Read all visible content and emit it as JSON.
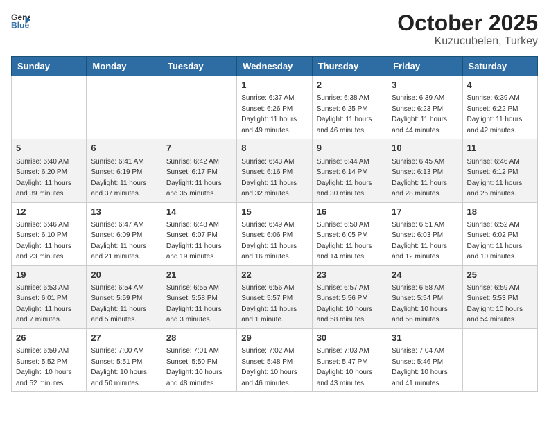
{
  "header": {
    "logo_general": "General",
    "logo_blue": "Blue",
    "title": "October 2025",
    "subtitle": "Kuzucubelen, Turkey"
  },
  "weekdays": [
    "Sunday",
    "Monday",
    "Tuesday",
    "Wednesday",
    "Thursday",
    "Friday",
    "Saturday"
  ],
  "weeks": [
    [
      {
        "day": "",
        "info": ""
      },
      {
        "day": "",
        "info": ""
      },
      {
        "day": "",
        "info": ""
      },
      {
        "day": "1",
        "info": "Sunrise: 6:37 AM\nSunset: 6:26 PM\nDaylight: 11 hours\nand 49 minutes."
      },
      {
        "day": "2",
        "info": "Sunrise: 6:38 AM\nSunset: 6:25 PM\nDaylight: 11 hours\nand 46 minutes."
      },
      {
        "day": "3",
        "info": "Sunrise: 6:39 AM\nSunset: 6:23 PM\nDaylight: 11 hours\nand 44 minutes."
      },
      {
        "day": "4",
        "info": "Sunrise: 6:39 AM\nSunset: 6:22 PM\nDaylight: 11 hours\nand 42 minutes."
      }
    ],
    [
      {
        "day": "5",
        "info": "Sunrise: 6:40 AM\nSunset: 6:20 PM\nDaylight: 11 hours\nand 39 minutes."
      },
      {
        "day": "6",
        "info": "Sunrise: 6:41 AM\nSunset: 6:19 PM\nDaylight: 11 hours\nand 37 minutes."
      },
      {
        "day": "7",
        "info": "Sunrise: 6:42 AM\nSunset: 6:17 PM\nDaylight: 11 hours\nand 35 minutes."
      },
      {
        "day": "8",
        "info": "Sunrise: 6:43 AM\nSunset: 6:16 PM\nDaylight: 11 hours\nand 32 minutes."
      },
      {
        "day": "9",
        "info": "Sunrise: 6:44 AM\nSunset: 6:14 PM\nDaylight: 11 hours\nand 30 minutes."
      },
      {
        "day": "10",
        "info": "Sunrise: 6:45 AM\nSunset: 6:13 PM\nDaylight: 11 hours\nand 28 minutes."
      },
      {
        "day": "11",
        "info": "Sunrise: 6:46 AM\nSunset: 6:12 PM\nDaylight: 11 hours\nand 25 minutes."
      }
    ],
    [
      {
        "day": "12",
        "info": "Sunrise: 6:46 AM\nSunset: 6:10 PM\nDaylight: 11 hours\nand 23 minutes."
      },
      {
        "day": "13",
        "info": "Sunrise: 6:47 AM\nSunset: 6:09 PM\nDaylight: 11 hours\nand 21 minutes."
      },
      {
        "day": "14",
        "info": "Sunrise: 6:48 AM\nSunset: 6:07 PM\nDaylight: 11 hours\nand 19 minutes."
      },
      {
        "day": "15",
        "info": "Sunrise: 6:49 AM\nSunset: 6:06 PM\nDaylight: 11 hours\nand 16 minutes."
      },
      {
        "day": "16",
        "info": "Sunrise: 6:50 AM\nSunset: 6:05 PM\nDaylight: 11 hours\nand 14 minutes."
      },
      {
        "day": "17",
        "info": "Sunrise: 6:51 AM\nSunset: 6:03 PM\nDaylight: 11 hours\nand 12 minutes."
      },
      {
        "day": "18",
        "info": "Sunrise: 6:52 AM\nSunset: 6:02 PM\nDaylight: 11 hours\nand 10 minutes."
      }
    ],
    [
      {
        "day": "19",
        "info": "Sunrise: 6:53 AM\nSunset: 6:01 PM\nDaylight: 11 hours\nand 7 minutes."
      },
      {
        "day": "20",
        "info": "Sunrise: 6:54 AM\nSunset: 5:59 PM\nDaylight: 11 hours\nand 5 minutes."
      },
      {
        "day": "21",
        "info": "Sunrise: 6:55 AM\nSunset: 5:58 PM\nDaylight: 11 hours\nand 3 minutes."
      },
      {
        "day": "22",
        "info": "Sunrise: 6:56 AM\nSunset: 5:57 PM\nDaylight: 11 hours\nand 1 minute."
      },
      {
        "day": "23",
        "info": "Sunrise: 6:57 AM\nSunset: 5:56 PM\nDaylight: 10 hours\nand 58 minutes."
      },
      {
        "day": "24",
        "info": "Sunrise: 6:58 AM\nSunset: 5:54 PM\nDaylight: 10 hours\nand 56 minutes."
      },
      {
        "day": "25",
        "info": "Sunrise: 6:59 AM\nSunset: 5:53 PM\nDaylight: 10 hours\nand 54 minutes."
      }
    ],
    [
      {
        "day": "26",
        "info": "Sunrise: 6:59 AM\nSunset: 5:52 PM\nDaylight: 10 hours\nand 52 minutes."
      },
      {
        "day": "27",
        "info": "Sunrise: 7:00 AM\nSunset: 5:51 PM\nDaylight: 10 hours\nand 50 minutes."
      },
      {
        "day": "28",
        "info": "Sunrise: 7:01 AM\nSunset: 5:50 PM\nDaylight: 10 hours\nand 48 minutes."
      },
      {
        "day": "29",
        "info": "Sunrise: 7:02 AM\nSunset: 5:48 PM\nDaylight: 10 hours\nand 46 minutes."
      },
      {
        "day": "30",
        "info": "Sunrise: 7:03 AM\nSunset: 5:47 PM\nDaylight: 10 hours\nand 43 minutes."
      },
      {
        "day": "31",
        "info": "Sunrise: 7:04 AM\nSunset: 5:46 PM\nDaylight: 10 hours\nand 41 minutes."
      },
      {
        "day": "",
        "info": ""
      }
    ]
  ]
}
